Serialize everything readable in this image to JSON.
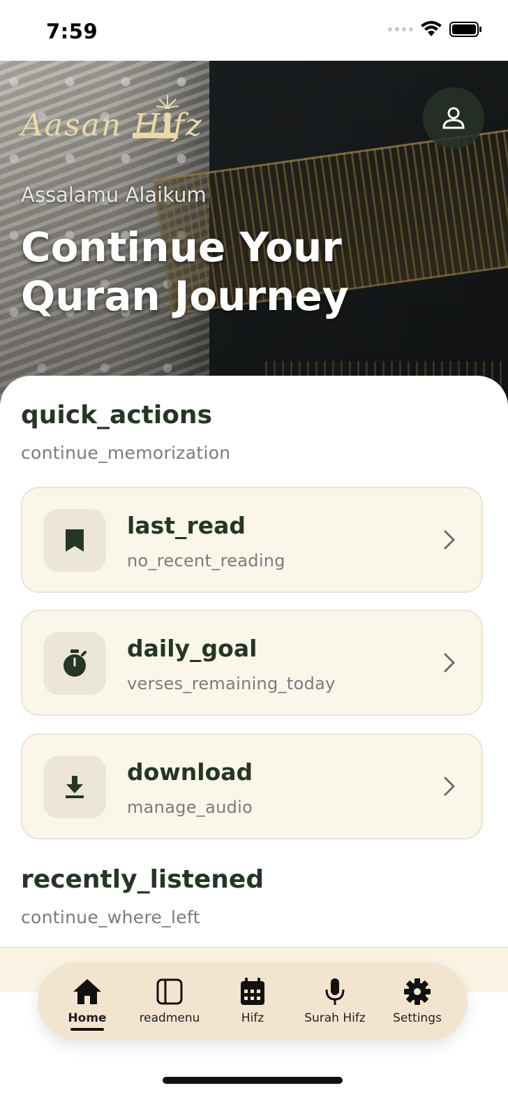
{
  "status_bar": {
    "time": "7:59"
  },
  "hero": {
    "logo": "Aasan Hifz",
    "greeting": "Assalamu Alaikum",
    "title_line1": "Continue Your",
    "title_line2": "Quran Journey"
  },
  "quick_actions": {
    "title": "quick_actions",
    "subtitle": "continue_memorization",
    "cards": [
      {
        "title": "last_read",
        "subtitle": "no_recent_reading",
        "icon": "bookmark-icon"
      },
      {
        "title": "daily_goal",
        "subtitle": "verses_remaining_today",
        "icon": "timer-icon"
      },
      {
        "title": "download",
        "subtitle": "manage_audio",
        "icon": "download-icon"
      }
    ]
  },
  "recently_listened": {
    "title": "recently_listened",
    "subtitle": "continue_where_left"
  },
  "tab_bar": {
    "active": "Home",
    "tabs": [
      {
        "label": "Home",
        "icon": "home-icon"
      },
      {
        "label": "readmenu",
        "icon": "book-panel-icon"
      },
      {
        "label": "Hifz",
        "icon": "calendar-icon"
      },
      {
        "label": "Surah Hifz",
        "icon": "microphone-icon"
      },
      {
        "label": "Settings",
        "icon": "gear-icon"
      }
    ]
  },
  "colors": {
    "accent_dark": "#263624",
    "card_bg": "#fbf6ea",
    "tab_bar_bg": "#f3e4cf",
    "logo_gold": "#e9d9a8"
  }
}
